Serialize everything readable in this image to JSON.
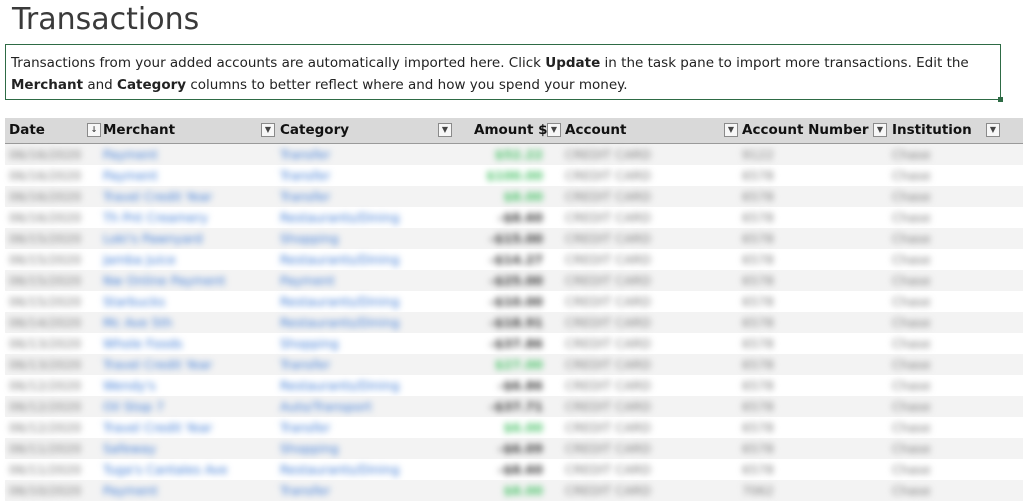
{
  "page": {
    "title": "Transactions",
    "note": {
      "part1": "Transactions from your added accounts are automatically imported here. Click ",
      "bold1": "Update",
      "part2": " in the task pane to import more transactions. Edit the ",
      "bold2": "Merchant",
      "part3": " and ",
      "bold3": "Category",
      "part4": " columns to better reflect where and how you spend your money."
    }
  },
  "table": {
    "columns": [
      {
        "key": "date",
        "label": "Date",
        "filter_icon": "sort-ascending-icon"
      },
      {
        "key": "merchant",
        "label": "Merchant",
        "filter_icon": "dropdown-arrow-icon"
      },
      {
        "key": "category",
        "label": "Category",
        "filter_icon": "dropdown-arrow-icon"
      },
      {
        "key": "amount",
        "label": "Amount $",
        "filter_icon": "dropdown-arrow-icon"
      },
      {
        "key": "account",
        "label": "Account",
        "filter_icon": "dropdown-arrow-icon"
      },
      {
        "key": "account_number",
        "label": "Account Number",
        "filter_icon": "dropdown-arrow-icon"
      },
      {
        "key": "institution",
        "label": "Institution",
        "filter_icon": "dropdown-arrow-icon"
      }
    ],
    "rows": [
      {
        "date": "06/16/2020",
        "merchant": "Payment",
        "category": "Transfer",
        "amount": "$52.22",
        "sign": "pos",
        "account": "CREDIT CARD",
        "account_number": "9122",
        "institution": "Chase"
      },
      {
        "date": "06/16/2020",
        "merchant": "Payment",
        "category": "Transfer",
        "amount": "$100.00",
        "sign": "pos",
        "account": "CREDIT CARD",
        "account_number": "6578",
        "institution": "Chase"
      },
      {
        "date": "06/16/2020",
        "merchant": "Travel Credit Year",
        "category": "Transfer",
        "amount": "$8.00",
        "sign": "pos",
        "account": "CREDIT CARD",
        "account_number": "6578",
        "institution": "Chase"
      },
      {
        "date": "06/16/2020",
        "merchant": "Th Pnt Creamery",
        "category": "Restaurants/Dining",
        "amount": "-$8.60",
        "sign": "neg",
        "account": "CREDIT CARD",
        "account_number": "6578",
        "institution": "Chase"
      },
      {
        "date": "06/15/2020",
        "merchant": "Loki's Pawnyard",
        "category": "Shopping",
        "amount": "-$15.00",
        "sign": "neg",
        "account": "CREDIT CARD",
        "account_number": "6578",
        "institution": "Chase"
      },
      {
        "date": "06/15/2020",
        "merchant": "Jamba Juice",
        "category": "Restaurants/Dining",
        "amount": "-$14.27",
        "sign": "neg",
        "account": "CREDIT CARD",
        "account_number": "6578",
        "institution": "Chase"
      },
      {
        "date": "06/15/2020",
        "merchant": "Nw Online Payment",
        "category": "Payment",
        "amount": "-$25.00",
        "sign": "neg",
        "account": "CREDIT CARD",
        "account_number": "6578",
        "institution": "Chase"
      },
      {
        "date": "06/15/2020",
        "merchant": "Starbucks",
        "category": "Restaurants/Dining",
        "amount": "-$10.00",
        "sign": "neg",
        "account": "CREDIT CARD",
        "account_number": "6578",
        "institution": "Chase"
      },
      {
        "date": "06/14/2020",
        "merchant": "Mc Ave 5th",
        "category": "Restaurants/Dining",
        "amount": "-$18.91",
        "sign": "neg",
        "account": "CREDIT CARD",
        "account_number": "6578",
        "institution": "Chase"
      },
      {
        "date": "06/13/2020",
        "merchant": "Whole Foods",
        "category": "Shopping",
        "amount": "-$37.86",
        "sign": "neg",
        "account": "CREDIT CARD",
        "account_number": "6578",
        "institution": "Chase"
      },
      {
        "date": "06/13/2020",
        "merchant": "Travel Credit Year",
        "category": "Transfer",
        "amount": "$27.00",
        "sign": "pos",
        "account": "CREDIT CARD",
        "account_number": "6578",
        "institution": "Chase"
      },
      {
        "date": "06/12/2020",
        "merchant": "Wendy's",
        "category": "Restaurants/Dining",
        "amount": "-$6.86",
        "sign": "neg",
        "account": "CREDIT CARD",
        "account_number": "6578",
        "institution": "Chase"
      },
      {
        "date": "06/12/2020",
        "merchant": "Oil Stop 7",
        "category": "Auto/Transport",
        "amount": "-$37.71",
        "sign": "neg",
        "account": "CREDIT CARD",
        "account_number": "6578",
        "institution": "Chase"
      },
      {
        "date": "06/12/2020",
        "merchant": "Travel Credit Year",
        "category": "Transfer",
        "amount": "$6.00",
        "sign": "pos",
        "account": "CREDIT CARD",
        "account_number": "6578",
        "institution": "Chase"
      },
      {
        "date": "06/11/2020",
        "merchant": "Safeway",
        "category": "Shopping",
        "amount": "-$6.09",
        "sign": "neg",
        "account": "CREDIT CARD",
        "account_number": "6578",
        "institution": "Chase"
      },
      {
        "date": "06/11/2020",
        "merchant": "Tuga's Cantales Ave",
        "category": "Restaurants/Dining",
        "amount": "-$8.60",
        "sign": "neg",
        "account": "CREDIT CARD",
        "account_number": "6578",
        "institution": "Chase"
      },
      {
        "date": "06/10/2020",
        "merchant": "Payment",
        "category": "Transfer",
        "amount": "$8.00",
        "sign": "pos",
        "account": "CREDIT CARD",
        "account_number": "7062",
        "institution": "Chase"
      }
    ]
  },
  "colors": {
    "note_border": "#2e6b45",
    "header_bg": "#d9d9d9",
    "link_text": "#3d7bd6",
    "positive_amount": "#4cc36a"
  }
}
